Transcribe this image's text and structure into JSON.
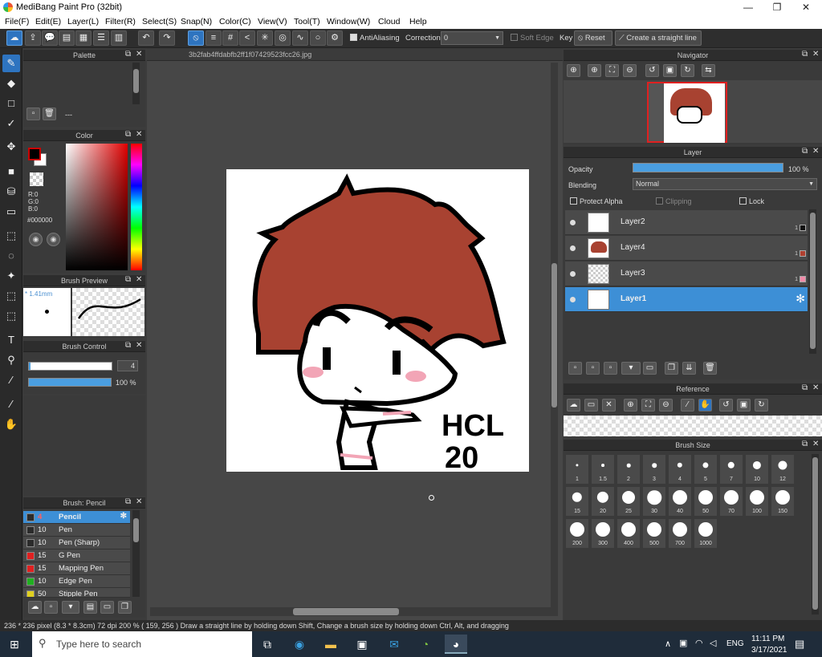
{
  "window": {
    "title": "MediBang Paint Pro (32bit)",
    "minimize": "—",
    "maximize": "❐",
    "close": "✕"
  },
  "menu": [
    "File(F)",
    "Edit(E)",
    "Layer(L)",
    "Filter(R)",
    "Select(S)",
    "Snap(N)",
    "Color(C)",
    "View(V)",
    "Tool(T)",
    "Window(W)",
    "Cloud",
    "Help"
  ],
  "toolbar": {
    "antialiasing": "AntiAliasing",
    "correction_label": "Correction",
    "correction_value": "0",
    "soft_edge": "Soft Edge",
    "key": "Key",
    "reset": "Reset",
    "straight_line": "Create a straight line"
  },
  "palette": {
    "title": "Palette",
    "dash": "---"
  },
  "color": {
    "title": "Color",
    "r": "R:0",
    "g": "G:0",
    "b": "B:0",
    "hex": "#000000",
    "primary": "#000000",
    "secondary": "#ffffff",
    "accent": "#cc0000"
  },
  "brush_preview": {
    "title": "Brush Preview",
    "size": "* 1.41mm"
  },
  "brush_control": {
    "title": "Brush Control",
    "size": "4",
    "opacity": "100 %",
    "size_fraction": 0.02,
    "opacity_fraction": 1.0
  },
  "brush_list": {
    "title": "Brush: Pencil",
    "items": [
      {
        "size": "4",
        "name": "Pencil",
        "color": "#2b2b2b",
        "selected": true
      },
      {
        "size": "10",
        "name": "Pen",
        "color": "#2b2b2b"
      },
      {
        "size": "10",
        "name": "Pen (Sharp)",
        "color": "#2b2b2b"
      },
      {
        "size": "15",
        "name": "G Pen",
        "color": "#e02020"
      },
      {
        "size": "15",
        "name": "Mapping Pen",
        "color": "#e02020"
      },
      {
        "size": "10",
        "name": "Edge Pen",
        "color": "#20b020"
      },
      {
        "size": "50",
        "name": "Stipple Pen",
        "color": "#e0d020"
      }
    ]
  },
  "document": {
    "tab": "3b2fab4ffdabfb2ff1f07429523fcc26.jpg",
    "art_text_line1": "HCL",
    "art_text_line2": "20"
  },
  "navigator": {
    "title": "Navigator"
  },
  "layer_panel": {
    "title": "Layer",
    "opacity_label": "Opacity",
    "opacity_value": "100 %",
    "opacity_fraction": 1.0,
    "blending_label": "Blending",
    "blending_value": "Normal",
    "protect_alpha": "Protect Alpha",
    "clipping": "Clipping",
    "lock": "Lock",
    "layers": [
      {
        "name": "Layer2",
        "one": "1",
        "swatch": "#111111"
      },
      {
        "name": "Layer4",
        "one": "1",
        "swatch": "#b04030"
      },
      {
        "name": "Layer3",
        "one": "1",
        "swatch": "#f08aa8"
      },
      {
        "name": "Layer1",
        "one": "",
        "swatch": ""
      }
    ]
  },
  "reference": {
    "title": "Reference"
  },
  "brush_size": {
    "title": "Brush Size",
    "values": [
      "1",
      "1.5",
      "2",
      "3",
      "4",
      "5",
      "7",
      "10",
      "12",
      "15",
      "20",
      "25",
      "30",
      "40",
      "50",
      "70",
      "100",
      "150",
      "200",
      "300",
      "400",
      "500",
      "700",
      "1000"
    ]
  },
  "status": {
    "text": "236 * 236 pixel  (8.3 * 8.3cm)  72 dpi  200 %  ( 159, 256 )  Draw a straight line by holding down Shift, Change a brush size by holding down Ctrl, Alt, and dragging"
  },
  "taskbar": {
    "search": "Type here to search",
    "lang": "ENG",
    "time": "11:11 PM",
    "date": "3/17/2021"
  }
}
